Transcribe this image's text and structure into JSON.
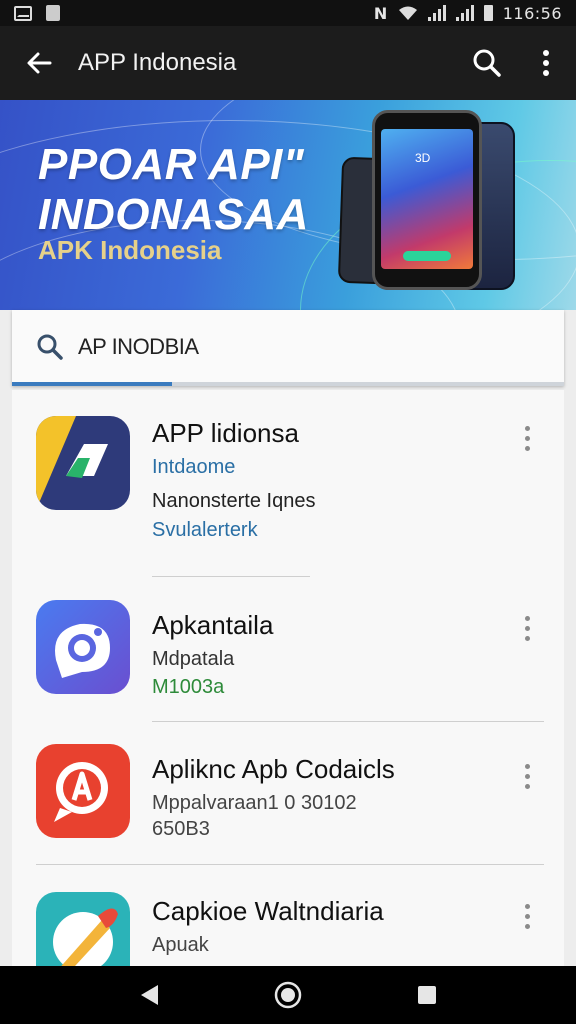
{
  "status_bar": {
    "right_text": "116:56"
  },
  "app_bar": {
    "title": "APP Indonesia",
    "back_icon": "arrow-left-icon",
    "search_icon": "search-icon",
    "menu_icon": "more-vert-icon"
  },
  "banner": {
    "headline_1": "PPOAR API\"",
    "headline_2": "INDONASAA",
    "subtitle": "APK Indonesia",
    "phone_screen_text": "3D"
  },
  "search": {
    "value": "AP INODBIA"
  },
  "tabs": {
    "active_progress": 0.29
  },
  "apps": [
    {
      "name": "APP lidionsa",
      "line1": "Intdaome",
      "line2": "Nanonsterte Iqnes",
      "line3": "Svulalerterk",
      "icon": "app-icon-yellow-navy"
    },
    {
      "name": "Apkantaila",
      "line1": "Mdpatala",
      "line2": "M1003a",
      "icon": "app-icon-camera"
    },
    {
      "name": "Apliknc Apb Codaicls",
      "line1": "Mppalvaraan1 0 30102",
      "line2": "650B3",
      "icon": "app-icon-red-a"
    },
    {
      "name": "Capkioe Waltndiaria",
      "line1": "Apuak",
      "icon": "app-icon-paintbrush"
    }
  ],
  "colors": {
    "app_bar": "#1c1c1c",
    "accent": "#3a7bbf",
    "link_blue": "#2a6fa5",
    "green": "#2e8b3a"
  },
  "nav_bar": {
    "back": "nav-back-icon",
    "home": "nav-home-icon",
    "recents": "nav-recents-icon"
  }
}
